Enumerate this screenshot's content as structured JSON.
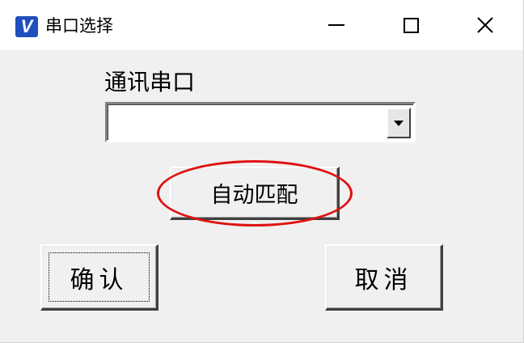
{
  "window": {
    "title": "串口选择",
    "icon": "v-app-icon",
    "controls": {
      "minimize": "minimize-icon",
      "maximize": "maximize-icon",
      "close": "close-icon"
    }
  },
  "form": {
    "port_label": "通讯串口",
    "port_value": "",
    "auto_match_label": "自动匹配",
    "ok_label": "确认",
    "cancel_label": "取消"
  },
  "annotation": {
    "highlight_color": "#e01010",
    "highlighted": "auto-match-button"
  }
}
